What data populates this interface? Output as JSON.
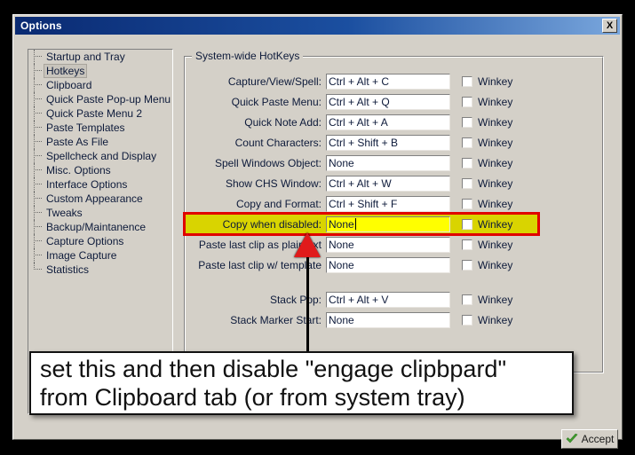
{
  "window": {
    "title": "Options",
    "close_label": "X"
  },
  "sidebar": {
    "items": [
      {
        "label": "Startup and Tray",
        "selected": false
      },
      {
        "label": "Hotkeys",
        "selected": true
      },
      {
        "label": "Clipboard",
        "selected": false
      },
      {
        "label": "Quick Paste Pop-up Menu",
        "selected": false
      },
      {
        "label": "Quick Paste Menu 2",
        "selected": false
      },
      {
        "label": "Paste Templates",
        "selected": false
      },
      {
        "label": "Paste As File",
        "selected": false
      },
      {
        "label": "Spellcheck and Display",
        "selected": false
      },
      {
        "label": "Misc. Options",
        "selected": false
      },
      {
        "label": "Interface Options",
        "selected": false
      },
      {
        "label": "Custom Appearance",
        "selected": false
      },
      {
        "label": "Tweaks",
        "selected": false
      },
      {
        "label": "Backup/Maintanence",
        "selected": false
      },
      {
        "label": "Capture Options",
        "selected": false
      },
      {
        "label": "Image Capture",
        "selected": false
      },
      {
        "label": "Statistics",
        "selected": false
      }
    ]
  },
  "groupbox": {
    "title": "System-wide HotKeys",
    "checkbox_label": "Winkey",
    "rows": [
      {
        "label": "Capture/View/Spell:",
        "value": "Ctrl + Alt + C",
        "winkey": false,
        "highlighted": false,
        "focused": false
      },
      {
        "label": "Quick Paste Menu:",
        "value": "Ctrl + Alt + Q",
        "winkey": false,
        "highlighted": false,
        "focused": false
      },
      {
        "label": "Quick Note Add:",
        "value": "Ctrl + Alt + A",
        "winkey": false,
        "highlighted": false,
        "focused": false
      },
      {
        "label": "Count Characters:",
        "value": "Ctrl + Shift + B",
        "winkey": false,
        "highlighted": false,
        "focused": false
      },
      {
        "label": "Spell Windows Object:",
        "value": "None",
        "winkey": false,
        "highlighted": false,
        "focused": false
      },
      {
        "label": "Show CHS Window:",
        "value": "Ctrl + Alt + W",
        "winkey": false,
        "highlighted": false,
        "focused": false
      },
      {
        "label": "Copy and Format:",
        "value": "Ctrl + Shift + F",
        "winkey": false,
        "highlighted": false,
        "focused": false
      },
      {
        "label": "Copy when disabled:",
        "value": "None",
        "winkey": false,
        "highlighted": true,
        "focused": true
      },
      {
        "label": "Paste last clip as plaintext",
        "value": "None",
        "winkey": false,
        "highlighted": false,
        "focused": false
      },
      {
        "label": "Paste last clip w/ template",
        "value": "None",
        "winkey": false,
        "highlighted": false,
        "focused": false
      },
      {
        "label": "",
        "value": null,
        "winkey": null,
        "highlighted": false,
        "focused": false
      },
      {
        "label": "Stack Pop:",
        "value": "Ctrl + Alt + V",
        "winkey": false,
        "highlighted": false,
        "focused": false
      },
      {
        "label": "Stack Marker Start:",
        "value": "None",
        "winkey": false,
        "highlighted": false,
        "focused": false
      }
    ]
  },
  "footer": {
    "accept_label": "Accept"
  },
  "annotation": {
    "line1": "set this and then disable \"engage clipbpard\"",
    "line2": "from Clipboard tab (or from system tray)"
  },
  "colors": {
    "titlebar_start": "#0a2a72",
    "titlebar_end": "#7aa7dd",
    "dialog_face": "#d4d0c8",
    "highlight_fill": "#d9d400",
    "highlight_border": "#e00000",
    "input_highlight": "#ffff00",
    "arrow_red": "#e01b1b",
    "accept_check_green": "#3f9e2d"
  }
}
